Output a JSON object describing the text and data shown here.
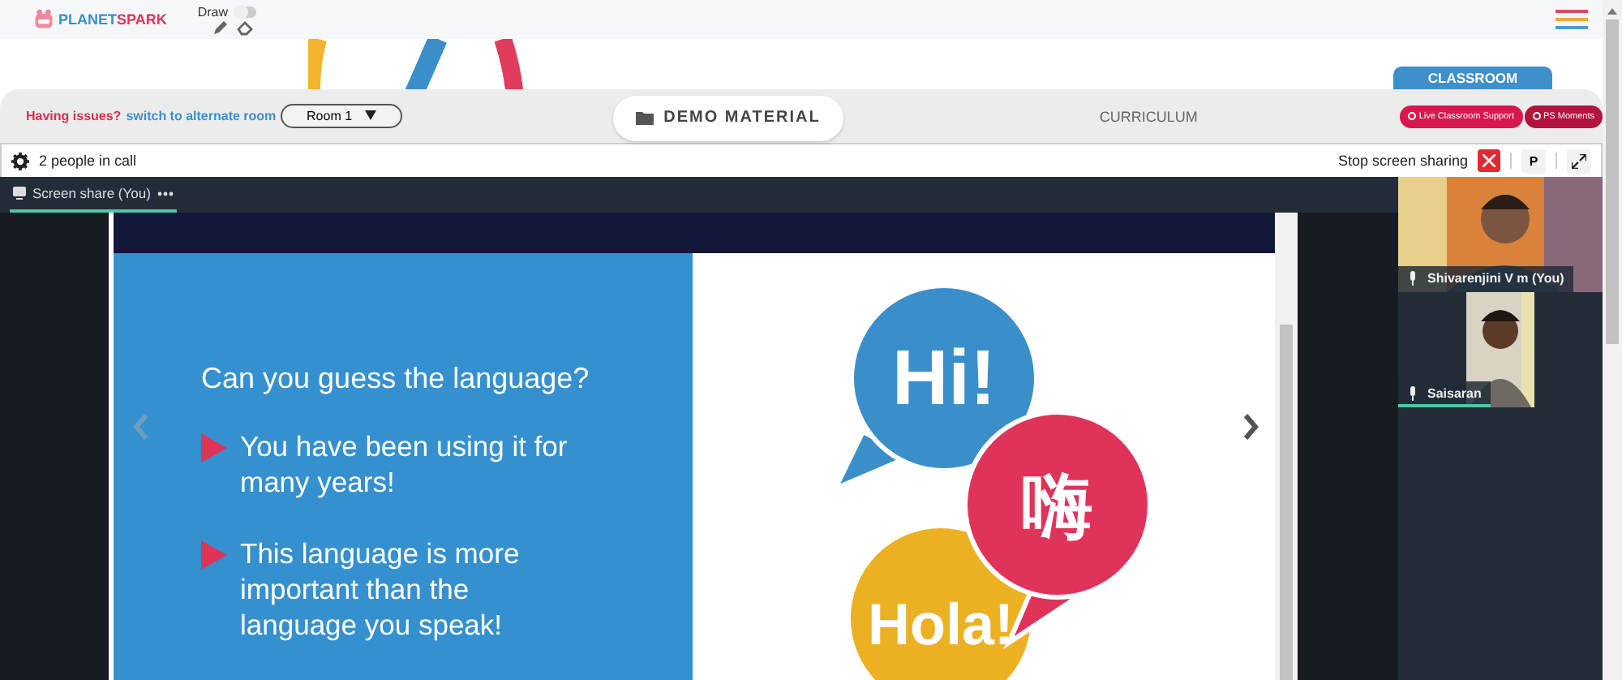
{
  "header": {
    "logo": {
      "part_1": "PLANET",
      "part_2": "SPARK"
    },
    "draw": {
      "label": "Draw",
      "on": false
    }
  },
  "room_bar": {
    "issue_text": "Having issues?",
    "switch_link": "switch to alternate room",
    "room_select": "Room 1",
    "classroom_label": "CLASSROOM",
    "tabs": [
      {
        "label": "DEMO MATERIAL",
        "selected": true
      },
      {
        "label": "CURRICULUM",
        "selected": false
      }
    ],
    "buttons": [
      "Live Classroom Support",
      "PS Moments"
    ]
  },
  "call_bar": {
    "people": "2 people in call",
    "stop_sharing": "Stop screen sharing",
    "p_button": "P"
  },
  "share_tab": {
    "label": "Screen share (You)",
    "selected": true
  },
  "slide": {
    "question": "Can you guess the language?",
    "bullets": [
      "You have been using it for many years!",
      "This language is more important than the language you speak!"
    ],
    "bubbles": [
      {
        "text": "Hi!",
        "color": "#3a8fcb"
      },
      {
        "text": "嗨",
        "color": "#e03359"
      },
      {
        "text": "Hola!",
        "color": "#ecb123"
      }
    ]
  },
  "participants": [
    {
      "name": "Shivarenjini V m (You)",
      "speaking": false
    },
    {
      "name": "Saisaran",
      "speaking": true
    }
  ]
}
